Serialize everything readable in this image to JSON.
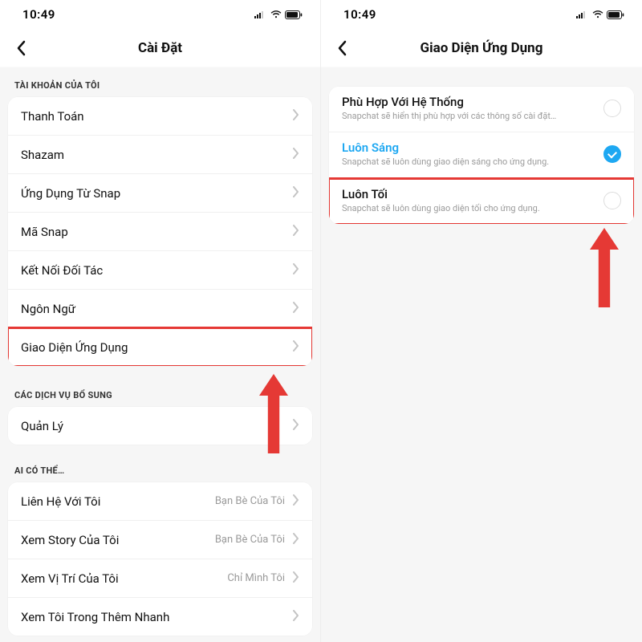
{
  "statusbar": {
    "time": "10:49"
  },
  "left": {
    "title": "Cài Đặt",
    "sections": {
      "account": {
        "header": "TÀI KHOẢN CỦA TÔI",
        "items": [
          "Thanh Toán",
          "Shazam",
          "Ứng Dụng Từ Snap",
          "Mã Snap",
          "Kết Nối Đối Tác",
          "Ngôn Ngữ",
          "Giao Diện Ứng Dụng"
        ]
      },
      "services": {
        "header": "CÁC DỊCH VỤ BỔ SUNG",
        "items": [
          "Quản Lý"
        ]
      },
      "whocan": {
        "header": "AI CÓ THỂ…",
        "items": [
          {
            "label": "Liên Hệ Với Tôi",
            "value": "Bạn Bè Của Tôi"
          },
          {
            "label": "Xem Story Của Tôi",
            "value": "Bạn Bè Của Tôi"
          },
          {
            "label": "Xem Vị Trí Của Tôi",
            "value": "Chỉ Mình Tôi"
          },
          {
            "label": "Xem Tôi Trong Thêm Nhanh",
            "value": ""
          }
        ]
      }
    }
  },
  "right": {
    "title": "Giao Diện Ứng Dụng",
    "options": [
      {
        "title": "Phù Hợp Với Hệ Thống",
        "sub": "Snapchat sẽ hiển thị phù hợp với các thông số cài đặt…",
        "selected": false
      },
      {
        "title": "Luôn Sáng",
        "sub": "Snapchat sẽ luôn dùng giao diện sáng cho ứng dụng.",
        "selected": true
      },
      {
        "title": "Luôn Tối",
        "sub": "Snapchat sẽ luôn dùng giao diện tối cho ứng dụng.",
        "selected": false
      }
    ]
  },
  "colors": {
    "highlight": "#E53935",
    "accent": "#1EA8F2"
  }
}
